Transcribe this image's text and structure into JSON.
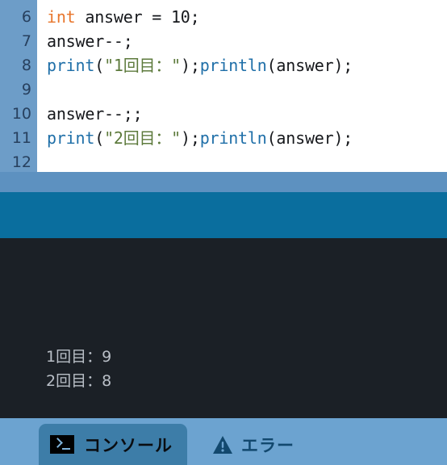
{
  "editor": {
    "gutter_color": "#6d9dc8",
    "gutter_text_color": "#27405e",
    "background": "#ffffff",
    "lines": [
      {
        "number": "6",
        "tokens": [
          {
            "text": "int",
            "type": "keyword"
          },
          {
            "text": " answer = 10;",
            "type": "plain"
          }
        ]
      },
      {
        "number": "7",
        "tokens": [
          {
            "text": "answer--;",
            "type": "plain"
          }
        ]
      },
      {
        "number": "8",
        "tokens": [
          {
            "text": "print",
            "type": "function"
          },
          {
            "text": "(",
            "type": "plain"
          },
          {
            "text": "\"1回目：\"",
            "type": "string"
          },
          {
            "text": ");",
            "type": "plain"
          },
          {
            "text": "println",
            "type": "function"
          },
          {
            "text": "(answer);",
            "type": "plain"
          }
        ]
      },
      {
        "number": "9",
        "tokens": []
      },
      {
        "number": "10",
        "tokens": [
          {
            "text": "answer--;;",
            "type": "plain"
          }
        ]
      },
      {
        "number": "11",
        "tokens": [
          {
            "text": "print",
            "type": "function"
          },
          {
            "text": "(",
            "type": "plain"
          },
          {
            "text": "\"2回目：\"",
            "type": "string"
          },
          {
            "text": ");",
            "type": "plain"
          },
          {
            "text": "println",
            "type": "function"
          },
          {
            "text": "(answer);",
            "type": "plain"
          }
        ]
      },
      {
        "number": "12",
        "tokens": []
      }
    ],
    "syntax_colors": {
      "keyword": "#e8762c",
      "function": "#1f6fa8",
      "string": "#5d7a3c",
      "plain": "#16181c"
    }
  },
  "bands": {
    "light_blue": "#5d91c0",
    "teal": "#0a6e9e"
  },
  "console": {
    "background": "#1b2026",
    "text_color": "#b9bfc7",
    "output_lines": [
      "1回目：9",
      "2回目：8"
    ]
  },
  "tabbar": {
    "background": "#6ca3d0",
    "active_tab_color": "#3d7da8",
    "tabs": [
      {
        "id": "console",
        "label": "コンソール",
        "icon": "terminal-icon",
        "active": true
      },
      {
        "id": "error",
        "label": "エラー",
        "icon": "warning-triangle-icon",
        "active": false
      }
    ]
  }
}
